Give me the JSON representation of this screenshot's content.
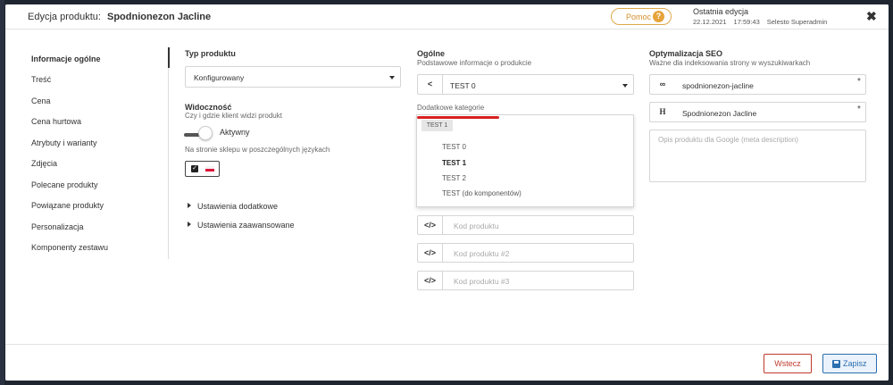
{
  "header": {
    "title_prefix": "Edycja produktu:",
    "product_name": "Spodnionezon Jacline",
    "help_label": "Pomoc",
    "help_icon": "?",
    "last_edit_title": "Ostatnia edycja",
    "last_edit_date": "22.12.2021",
    "last_edit_time": "17:59:43",
    "last_edit_user": "Selesto Superadmin",
    "close_icon": "✖"
  },
  "sidebar": {
    "items": [
      {
        "label": "Informacje ogólne",
        "active": true
      },
      {
        "label": "Treść"
      },
      {
        "label": "Cena"
      },
      {
        "label": "Cena hurtowa"
      },
      {
        "label": "Atrybuty i warianty"
      },
      {
        "label": "Zdjęcia"
      },
      {
        "label": "Polecane produkty"
      },
      {
        "label": "Powiązane produkty"
      },
      {
        "label": "Personalizacja"
      },
      {
        "label": "Komponenty zestawu"
      }
    ]
  },
  "product_type": {
    "label": "Typ produktu",
    "value": "Konfigurowany"
  },
  "visibility": {
    "label": "Widoczność",
    "sub": "Czy i gdzie klient widzi produkt",
    "toggle_label": "Aktywny",
    "lang_label": "Na stronie sklepu w poszczególnych językach"
  },
  "collapsibles": {
    "extra": "Ustawienia dodatkowe",
    "advanced": "Ustawienia zaawansowane"
  },
  "general": {
    "label": "Ogólne",
    "sub": "Podstawowe informacje o produkcie",
    "category_value": "TEST 0",
    "extra_categories_label": "Dodatkowe kategorie",
    "selected_tag": "TEST 1",
    "options": [
      "TEST 0",
      "TEST 1",
      "TEST 2",
      "TEST (do komponentów)"
    ],
    "selected_option": "TEST 1",
    "code_placeholder": "Kod produktu",
    "code2_placeholder": "Kod produktu #2",
    "code3_placeholder": "Kod produktu #3"
  },
  "seo": {
    "label": "Optymalizacja SEO",
    "sub": "Ważne dla indeksowania strony w wyszukiwarkach",
    "slug": "spodnionezon-jacline",
    "title": "Spodnionezon Jacline",
    "meta_placeholder": "Opis produktu dla Google (meta description)"
  },
  "footer": {
    "back_label": "Wstecz",
    "save_label": "Zapisz"
  },
  "colors": {
    "accent": "#2a6fb0",
    "danger": "#c0392b",
    "help": "#e6a33a"
  }
}
